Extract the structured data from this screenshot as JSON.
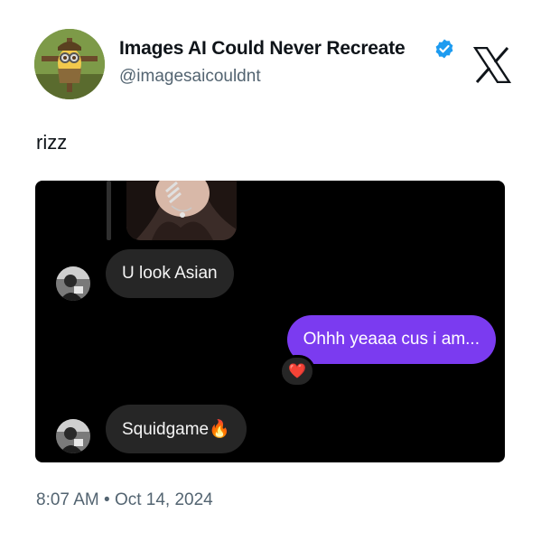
{
  "author": {
    "display_name": "Images AI Could Never Recreate",
    "handle": "@imagesaicouldnt",
    "avatar_icon": "minion-scarecrow-avatar",
    "verified_icon": "verified-badge-icon",
    "verified_color": "#1d9bf0"
  },
  "platform_logo": "x-logo-icon",
  "tweet": {
    "text": "rizz",
    "timestamp": "8:07 AM",
    "separator": "•",
    "date": "Oct 14, 2024"
  },
  "chat": {
    "messages": [
      {
        "from": "them",
        "text": "U look Asian"
      },
      {
        "from": "me",
        "text": "Ohhh yeaaa cus i am...",
        "reaction": "❤️"
      },
      {
        "from": "them",
        "text": "Squidgame🔥"
      }
    ],
    "colors": {
      "background": "#000000",
      "received_bubble": "#262626",
      "sent_bubble": "#7b3bf0"
    }
  }
}
